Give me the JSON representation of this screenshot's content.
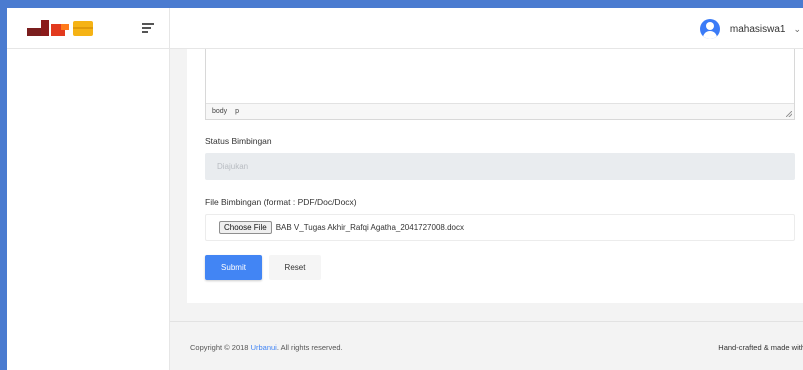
{
  "header": {
    "username": "mahasiswa1"
  },
  "editor": {
    "path": [
      "body",
      "p"
    ]
  },
  "form": {
    "status_label": "Status Bimbingan",
    "status_value": "Diajukan",
    "file_label": "File Bimbingan (format : PDF/Doc/Docx)",
    "choose_file_label": "Choose File",
    "file_name": "BAB V_Tugas Akhir_Rafqi Agatha_2041727008.docx",
    "submit_label": "Submit",
    "reset_label": "Reset"
  },
  "footer": {
    "copyright_prefix": "Copyright © 2018 ",
    "brand_link": "Urbanui",
    "copyright_suffix": ". All rights reserved.",
    "handcrafted": "Hand-crafted & made with"
  },
  "colors": {
    "primary": "#4285f4",
    "frame": "#4a7bd0"
  }
}
